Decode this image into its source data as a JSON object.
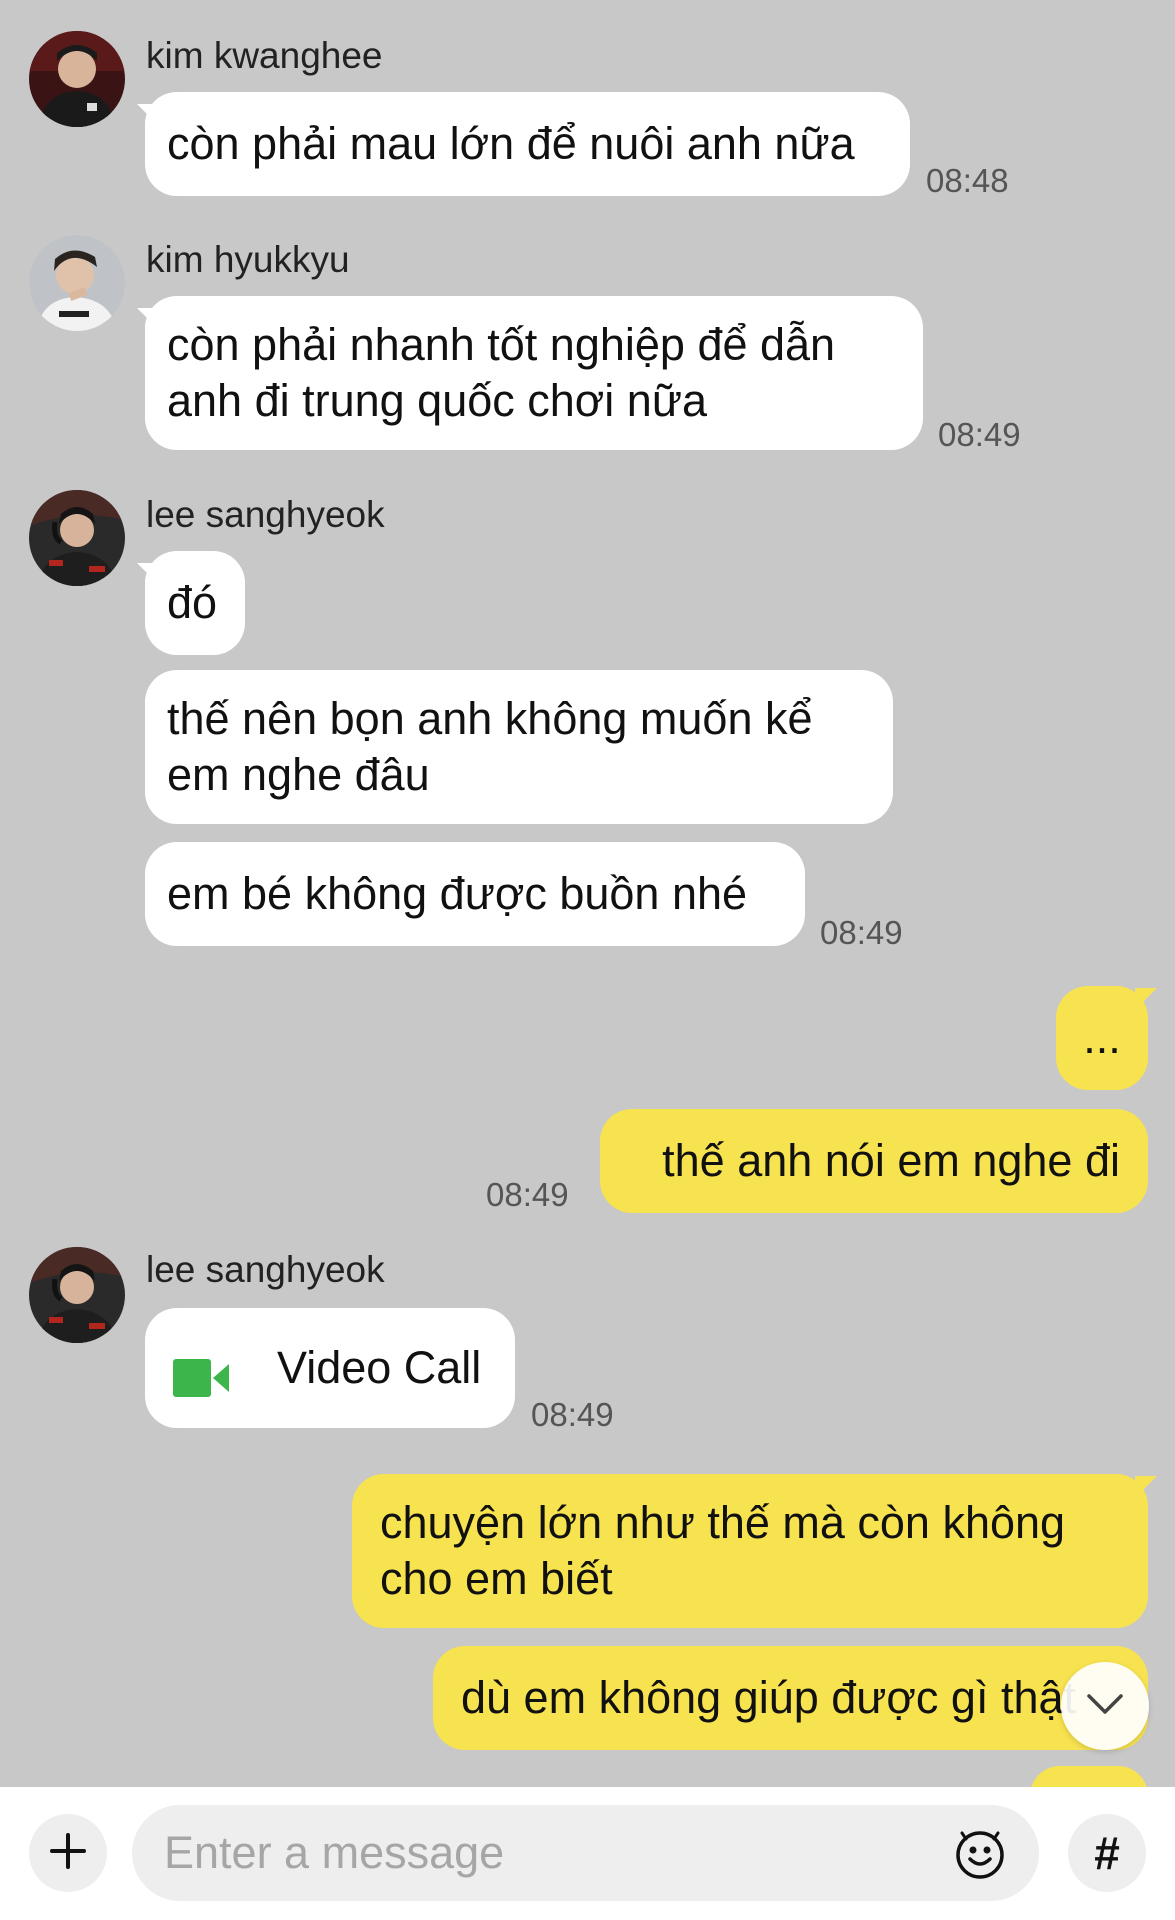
{
  "messages": [
    {
      "sender": "kim kwanghee",
      "text": "còn phải mau lớn để nuôi anh nữa",
      "time": "08:48"
    },
    {
      "sender": "kim hyukkyu",
      "line1": "còn phải nhanh tốt nghiệp để dẫn",
      "line2": "anh đi trung quốc chơi nữa",
      "time": "08:49"
    },
    {
      "sender": "lee sanghyeok",
      "text1": "đó",
      "text2_line1": "thế nên bọn anh không muốn kể",
      "text2_line2": "em nghe đâu",
      "text3": "em bé không được buồn nhé",
      "time": "08:49"
    },
    {
      "text1": "...",
      "text2": "thế anh nói em nghe đi",
      "time": "08:49"
    },
    {
      "sender": "lee sanghyeok",
      "call_label": "Video Call",
      "time": "08:49"
    },
    {
      "line1": "chuyện lớn như thế mà còn không",
      "line2": "cho em biết",
      "text2": "dù em không giúp được gì thật"
    }
  ],
  "composer": {
    "placeholder": "Enter a message",
    "hash_label": "#"
  },
  "icons": {
    "attach": "plus-icon",
    "emoji": "emoji-icon",
    "hashtag": "hashtag-icon",
    "video_call": "video-camera-icon",
    "scroll_down": "chevron-down-icon"
  },
  "colors": {
    "background": "#c8c8c8",
    "incoming_bubble": "#ffffff",
    "outgoing_bubble": "#f7e24f",
    "video_call_green": "#3cb54a"
  }
}
